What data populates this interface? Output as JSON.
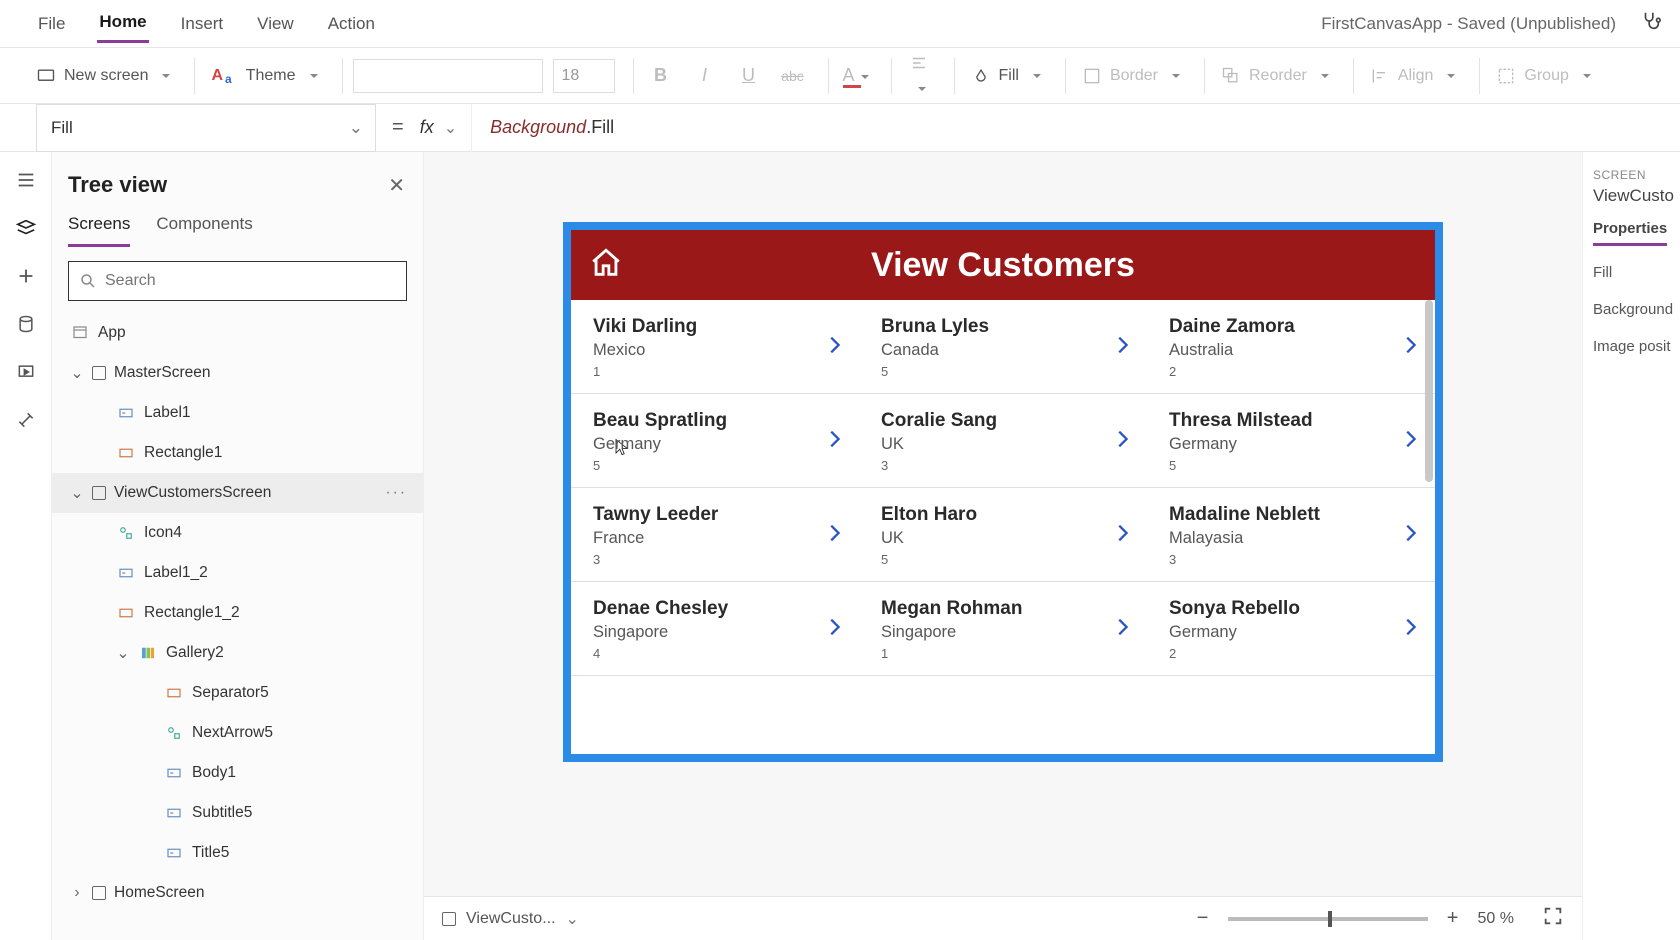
{
  "app": {
    "title": "FirstCanvasApp - Saved (Unpublished)"
  },
  "menu": {
    "file": "File",
    "home": "Home",
    "insert": "Insert",
    "view": "View",
    "action": "Action"
  },
  "ribbon": {
    "new_screen": "New screen",
    "theme": "Theme",
    "font_size": "18",
    "fill": "Fill",
    "border": "Border",
    "reorder": "Reorder",
    "align": "Align",
    "group": "Group"
  },
  "formula": {
    "property": "Fill",
    "expr_obj": "Background",
    "expr_rest": ".Fill"
  },
  "tree": {
    "title": "Tree view",
    "tab_screens": "Screens",
    "tab_components": "Components",
    "search_placeholder": "Search",
    "nodes": {
      "app": "App",
      "master": "MasterScreen",
      "label1": "Label1",
      "rect1": "Rectangle1",
      "viewcust": "ViewCustomersScreen",
      "icon4": "Icon4",
      "label1_2": "Label1_2",
      "rect1_2": "Rectangle1_2",
      "gallery2": "Gallery2",
      "sep5": "Separator5",
      "next5": "NextArrow5",
      "body1": "Body1",
      "sub5": "Subtitle5",
      "title5": "Title5",
      "homescr": "HomeScreen"
    }
  },
  "canvas": {
    "header": "View Customers",
    "customers": [
      {
        "name": "Viki  Darling",
        "country": "Mexico",
        "num": "1"
      },
      {
        "name": "Bruna  Lyles",
        "country": "Canada",
        "num": "5"
      },
      {
        "name": "Daine  Zamora",
        "country": "Australia",
        "num": "2"
      },
      {
        "name": "Beau  Spratling",
        "country": "Germany",
        "num": "5"
      },
      {
        "name": "Coralie  Sang",
        "country": "UK",
        "num": "3"
      },
      {
        "name": "Thresa  Milstead",
        "country": "Germany",
        "num": "5"
      },
      {
        "name": "Tawny  Leeder",
        "country": "France",
        "num": "3"
      },
      {
        "name": "Elton  Haro",
        "country": "UK",
        "num": "5"
      },
      {
        "name": "Madaline  Neblett",
        "country": "Malayasia",
        "num": "3"
      },
      {
        "name": "Denae  Chesley",
        "country": "Singapore",
        "num": "4"
      },
      {
        "name": "Megan  Rohman",
        "country": "Singapore",
        "num": "1"
      },
      {
        "name": "Sonya  Rebello",
        "country": "Germany",
        "num": "2"
      }
    ]
  },
  "zoom": {
    "crumb": "ViewCusto...",
    "pct": "50  %"
  },
  "right": {
    "label": "SCREEN",
    "screen": "ViewCusto",
    "tab": "Properties",
    "p1": "Fill",
    "p2": "Background",
    "p3": "Image posit"
  }
}
